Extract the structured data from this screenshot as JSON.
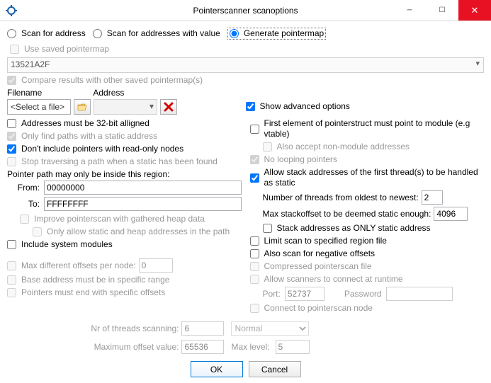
{
  "window": {
    "title": "Pointerscanner scanoptions"
  },
  "modeRow": {
    "scanForAddress": "Scan for address",
    "scanForAddressesWithValue": "Scan for addresses with value",
    "generatePointermap": "Generate pointermap"
  },
  "useSavedPointermap": "Use saved pointermap",
  "addressValue": "13521A2F",
  "compareResults": "Compare results with other saved pointermap(s)",
  "fileHeaders": {
    "filename": "Filename",
    "address": "Address"
  },
  "fileRow": {
    "selectAFile": "<Select a file>"
  },
  "showAdvanced": "Show advanced options",
  "left": {
    "addr32": "Addresses must be 32-bit alligned",
    "onlyStatic": "Only find paths with a static address",
    "noReadOnly": "Don't include pointers with read-only nodes",
    "stopTraversing": "Stop traversing a path when a static has been found",
    "regionLabel": "Pointer path may only be inside this region:",
    "fromLabel": "From:",
    "fromValue": "00000000",
    "toLabel": "To:",
    "toValue": "FFFFFFFF",
    "improveHeap": "Improve pointerscan with gathered heap data",
    "onlyStaticHeap": "Only allow static and heap addresses in the path",
    "includeSystem": "Include system modules",
    "maxDiffOffsets": "Max different offsets per node:",
    "maxDiffOffsetsValue": "0",
    "baseInRange": "Base address must be in specific range",
    "endWithOffsets": "Pointers must end with specific offsets"
  },
  "right": {
    "firstElement": "First element of pointerstruct must point to module (e.g vtable)",
    "acceptNonModule": "Also accept non-module addresses",
    "noLooping": "No looping pointers",
    "allowStackFirst": "Allow stack addresses of the first thread(s) to be handled as static",
    "numThreadsLabel": "Number of threads from oldest to newest:",
    "numThreadsValue": "2",
    "maxStackOffsetLabel": "Max stackoffset to be deemed static enough:",
    "maxStackOffsetValue": "4096",
    "stackOnlyStatic": "Stack addresses as ONLY static address",
    "limitRegionFile": "Limit scan to specified region file",
    "alsoNegative": "Also scan for negative offsets",
    "compressedFile": "Compressed pointerscan file",
    "allowScanners": "Allow scanners to connect at runtime",
    "portLabel": "Port:",
    "portValue": "52737",
    "passwordLabel": "Password",
    "passwordValue": "",
    "connectNode": "Connect to pointerscan node"
  },
  "bottom": {
    "nrThreadsLabel": "Nr of threads scanning:",
    "nrThreadsValue": "6",
    "priorityValue": "Normal",
    "maxOffsetLabel": "Maximum offset value:",
    "maxOffsetValue": "65536",
    "maxLevelLabel": "Max level:",
    "maxLevelValue": "5"
  },
  "buttons": {
    "ok": "OK",
    "cancel": "Cancel"
  }
}
